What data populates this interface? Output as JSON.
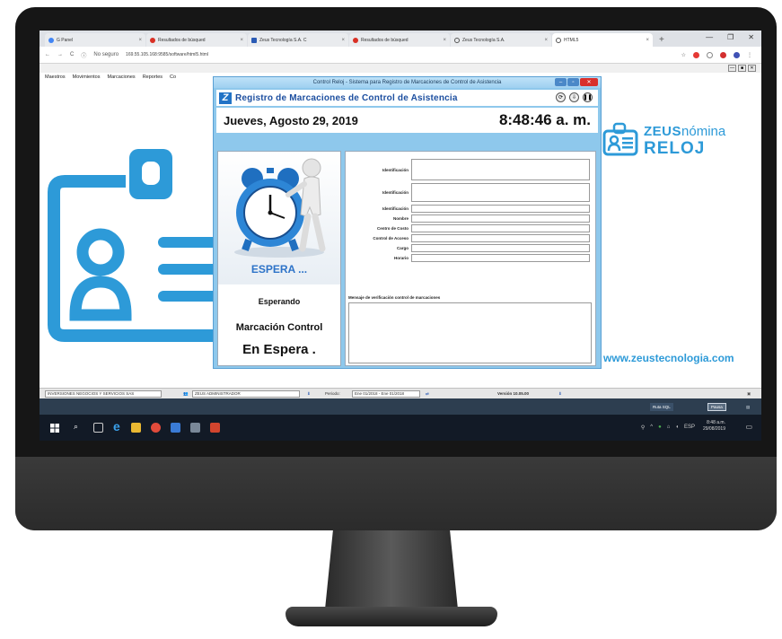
{
  "browser": {
    "tabs": [
      {
        "label": "G  Panel",
        "color": "#4285f4"
      },
      {
        "label": "Resultados de búsqued",
        "color": "#d93025"
      },
      {
        "label": "Zeus Tecnología S.A. C",
        "color": "#2b5bb5"
      },
      {
        "label": "Resultados de búsqued",
        "color": "#d93025"
      },
      {
        "label": "Zeus Tecnología S.A.",
        "color": "#555555"
      },
      {
        "label": "HTML5",
        "color": "#555555",
        "active": true
      }
    ],
    "new_tab": "+",
    "window_controls": [
      "—",
      "❐",
      "✕"
    ],
    "nav": [
      "←",
      "→",
      "C"
    ],
    "security": "No seguro",
    "url": "169.55.105.168:9585/software/html5.html"
  },
  "app_menu": [
    "Maestros",
    "Movimientos",
    "Marcaciones",
    "Reportes",
    "Co"
  ],
  "mdi_controls": [
    "—",
    "■",
    "✕"
  ],
  "brand": {
    "zeus": "ZEUS",
    "nomina": "nómina",
    "reloj": "RELOJ",
    "website": "www.zeustecnologia.com"
  },
  "dialog": {
    "window_title": "Control Reloj - Sistema para Registro de Marcaciones de Control de Asistencia",
    "heading": "Registro de Marcaciones de Control de Asistencia",
    "date": "Jueves, Agosto 29, 2019",
    "time": "8:48:46 a. m.",
    "status_image_text": "ESPERA ...",
    "status": "Esperando",
    "mode_line1": "Marcación Control",
    "mode_line2": "En Espera .",
    "fields": [
      "Identificación",
      "Identificación",
      "Identificación",
      "Nombre",
      "Centro de Costo",
      "Control de Acceso",
      "Cargo",
      "Horario"
    ],
    "message_label": "Mensaje de verificación control de marcaciones",
    "colors": {
      "accent": "#1d4fa0",
      "frame": "#8ec8ec",
      "espera": "#2d73c8"
    }
  },
  "statusbar": {
    "company": "INVERSIONES NEGOCIOS Y SERVICIOS SAS",
    "user": "ZEUS ADMINISTRADOR",
    "period_label": "Periodo:",
    "period_value": "Ene 01/2018 - Ene 01/2018",
    "version": "Versión 10.05.00"
  },
  "strip": {
    "btn1": "Ruta SQL",
    "btn2": "Pausa"
  },
  "taskbar": {
    "time": "8:48 a.m.",
    "date": "29/08/2019",
    "lang": "ESP"
  },
  "brand_color": "#2d9ad8"
}
